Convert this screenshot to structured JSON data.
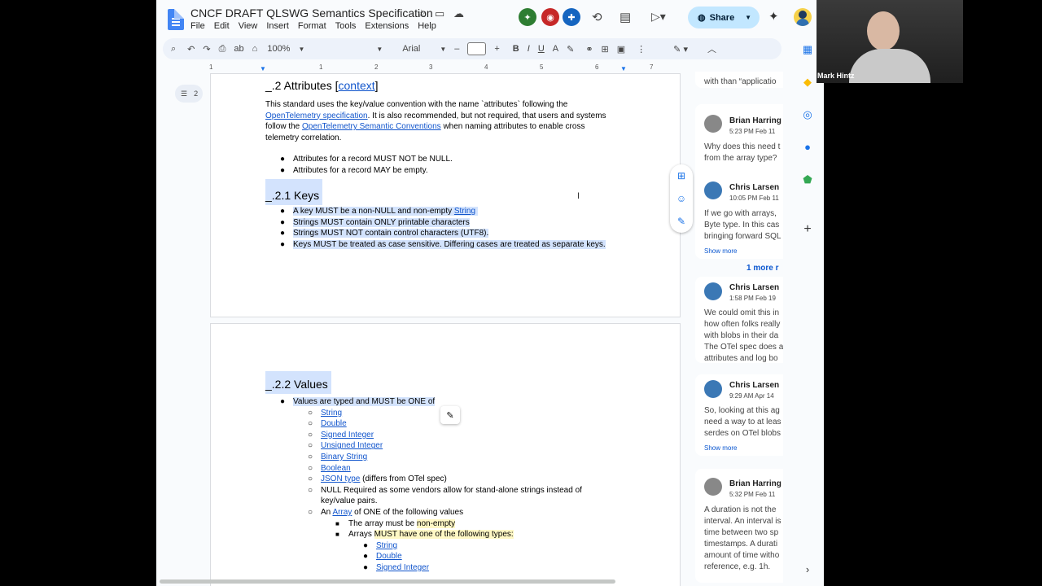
{
  "doc": {
    "title": "CNCF DRAFT QLSWG Semantics Specification",
    "menu": [
      "File",
      "Edit",
      "View",
      "Insert",
      "Format",
      "Tools",
      "Extensions",
      "Help"
    ]
  },
  "header": {
    "share_label": "Share"
  },
  "toolbar": {
    "zoom": "100%",
    "font": "Arial",
    "size": ""
  },
  "ruler": {
    "ticks": [
      "1",
      "1",
      "2",
      "3",
      "4",
      "5",
      "6",
      "7"
    ]
  },
  "outline": {
    "count": "2"
  },
  "page1": {
    "heading_prefix": "_.2 Attributes [",
    "heading_link": "context",
    "heading_suffix": "]",
    "p1_a": "This standard uses the key/value convention with the name `attributes` following the",
    "p1_link1": "OpenTelemetry specification",
    "p1_b": ". It is also recommended, but not required, that users and systems",
    "p1_c": "follow the ",
    "p1_link2": "OpenTelemetry Semantic Conventions",
    "p1_d": " when naming attributes to enable cross",
    "p1_e": "telemetry correlation.",
    "bullets1": [
      "Attributes for a record MUST NOT be NULL.",
      "Attributes for a record MAY be empty."
    ],
    "h_keys": "_.2.1 Keys",
    "keys_b1_a": "A key MUST be a non-NULL and non-empty ",
    "keys_b1_link": "String",
    "keys_b2": "Strings MUST contain ONLY printable characters",
    "keys_b3": "Strings MUST NOT contain control characters (UTF8).",
    "keys_b4": "Keys MUST be treated as case sensitive. Differing cases are treated as separate keys."
  },
  "page2": {
    "h_values": "_.2.2 Values",
    "v_b1": "Values are typed and MUST be ONE of",
    "types": [
      "String",
      "Double",
      "Signed Integer",
      "Unsigned Integer",
      "Binary String",
      "Boolean"
    ],
    "json_link": "JSON type",
    "json_rest": " (differs from OTel spec)",
    "null_a": "NULL Required as some vendors allow for stand-alone strings instead of",
    "null_b": "key/value pairs.",
    "array_a": "An ",
    "array_link": "Array",
    "array_b": " of ONE of the following values",
    "arr_s1_a": "The array must be ",
    "arr_s1_b": "non-empty",
    "arr_s2_a": "Arrays ",
    "arr_s2_b": "MUST have one of the following types:",
    "arr_types": [
      "String",
      "Double",
      "Signed Integer"
    ]
  },
  "comments": [
    {
      "top_text": "with than “applicatio"
    },
    {
      "name": "Brian Harring",
      "time": "5:23 PM Feb 11",
      "lines": [
        "Why does this need t",
        "from the array type?"
      ]
    },
    {
      "name": "Chris Larsen",
      "time": "10:05 PM Feb 11",
      "lines": [
        "If we go with arrays,",
        "Byte type. In this cas",
        "bringing forward SQL"
      ],
      "more": "Show more"
    },
    {
      "reply_count": "1 more r"
    },
    {
      "name": "Chris Larsen",
      "time": "1:58 PM Feb 19",
      "lines": [
        "We could omit this in",
        "how often folks really",
        "with blobs in their da",
        "The OTel spec does a",
        "attributes and log bo"
      ]
    },
    {
      "name": "Chris Larsen",
      "time": "9:29 AM Apr 14",
      "lines": [
        "So, looking at this ag",
        "need a way to at leas",
        "serdes on OTel blobs"
      ],
      "more": "Show more"
    },
    {
      "name": "Brian Harring",
      "time": "5:32 PM Feb 11",
      "lines": [
        "A duration is not the",
        "interval. An interval is",
        "time between two sp",
        "timestamps. A durati",
        "amount of time witho",
        "reference, e.g. 1h."
      ]
    }
  ],
  "video": {
    "name": "Mark Hintz"
  },
  "colors": {
    "accent": "#1a73e8",
    "selection": "#d3e3fd",
    "share": "#c2e7ff"
  }
}
